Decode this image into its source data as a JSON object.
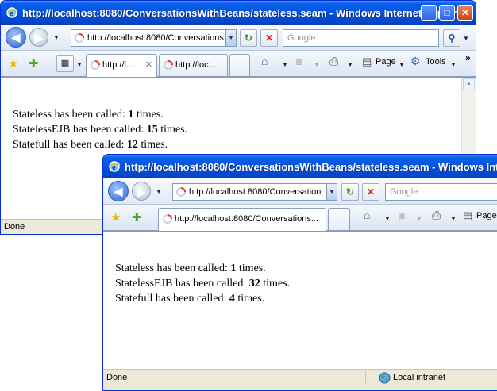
{
  "win1": {
    "title": "http://localhost:8080/ConversationsWithBeans/stateless.seam - Windows Internet Explorer",
    "address": "http://localhost:8080/Conversations",
    "search_placeholder": "Google",
    "tabs": [
      "http://l...",
      "http://loc..."
    ],
    "page_label": "Page",
    "tools_label": "Tools",
    "messages": [
      {
        "pre": "Stateless has been called: ",
        "count": "1",
        "post": " times."
      },
      {
        "pre": "StatelessEJB has been called: ",
        "count": "15",
        "post": " times."
      },
      {
        "pre": "Statefull has been called: ",
        "count": "12",
        "post": " times."
      }
    ],
    "status": "Done"
  },
  "win2": {
    "title": "http://localhost:8080/ConversationsWithBeans/stateless.seam - Windows Inte",
    "address": "http://localhost:8080/Conversation",
    "search_placeholder": "Google",
    "tabs": [
      "http://localhost:8080/Conversations..."
    ],
    "page_label": "Page",
    "messages": [
      {
        "pre": "Stateless has been called: ",
        "count": "1",
        "post": " times."
      },
      {
        "pre": "StatelessEJB has been called: ",
        "count": "32",
        "post": " times."
      },
      {
        "pre": "Statefull has been called: ",
        "count": "4",
        "post": " times."
      }
    ],
    "status": "Done",
    "zone": "Local intranet"
  },
  "icons": {
    "caption_buttons": [
      "minimize-icon",
      "maximize-icon",
      "close-icon"
    ],
    "nav": [
      "back-icon",
      "forward-icon",
      "refresh-icon",
      "stop-icon",
      "search-go-icon"
    ],
    "toolbar": [
      "favorites-star-icon",
      "add-favorites-icon",
      "quick-tabs-icon",
      "home-icon",
      "feeds-icon",
      "print-icon",
      "page-icon",
      "tools-gear-icon",
      "globe-icon"
    ]
  },
  "colors": {
    "titlebar": "#0054e3",
    "window_frame": "#0831d9",
    "chrome": "#ece9d8"
  }
}
